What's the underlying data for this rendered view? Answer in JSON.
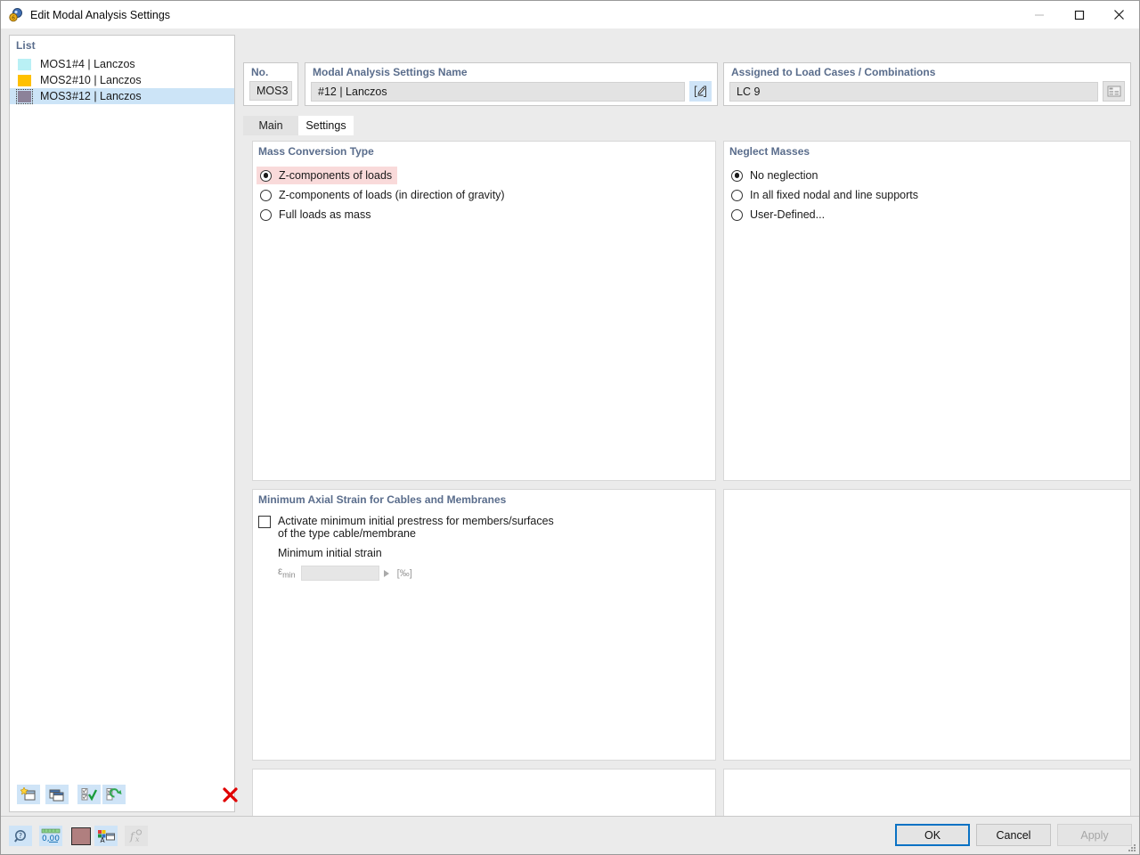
{
  "window": {
    "title": "Edit Modal Analysis Settings",
    "icon": "modal-analysis-icon",
    "controls": {
      "minimize": "minimize-icon",
      "maximize": "maximize-icon",
      "close": "close-icon"
    }
  },
  "list_panel": {
    "header": "List",
    "rows": [
      {
        "no": "MOS1",
        "text": "#4 | Lanczos",
        "color": "#b9f0f5",
        "selected": false
      },
      {
        "no": "MOS2",
        "text": "#10 | Lanczos",
        "color": "#ffc000",
        "selected": false
      },
      {
        "no": "MOS3",
        "text": "#12 | Lanczos",
        "color": "#8c8299",
        "selected": true
      }
    ],
    "toolbar": [
      {
        "name": "new-item-button",
        "icon": "new-window-star-icon"
      },
      {
        "name": "copy-item-button",
        "icon": "copy-windows-icon"
      },
      {
        "name": "select-all-button",
        "icon": "checkbox-check-icon"
      },
      {
        "name": "invert-selection-button",
        "icon": "checkbox-refresh-icon"
      },
      {
        "name": "delete-item-button",
        "icon": "red-x-icon"
      }
    ]
  },
  "no_group": {
    "label": "No.",
    "value": "MOS3"
  },
  "name_group": {
    "label": "Modal Analysis Settings Name",
    "value": "#12 | Lanczos",
    "edit_button_icon": "pencil-edit-icon"
  },
  "assign_group": {
    "label": "Assigned to Load Cases / Combinations",
    "value": "LC 9",
    "select_button_icon": "table-select-icon"
  },
  "tabs": [
    {
      "label": "Main",
      "active": false
    },
    {
      "label": "Settings",
      "active": true
    }
  ],
  "mass_conversion": {
    "title": "Mass Conversion Type",
    "options": [
      {
        "label": "Z-components of loads",
        "selected": true,
        "highlight": true
      },
      {
        "label": "Z-components of loads (in direction of gravity)",
        "selected": false,
        "highlight": false
      },
      {
        "label": "Full loads as mass",
        "selected": false,
        "highlight": false
      }
    ]
  },
  "neglect_masses": {
    "title": "Neglect Masses",
    "options": [
      {
        "label": "No neglection",
        "selected": true
      },
      {
        "label": "In all fixed nodal and line supports",
        "selected": false
      },
      {
        "label": "User-Defined...",
        "selected": false
      }
    ]
  },
  "min_axial_strain": {
    "title": "Minimum Axial Strain for Cables and Membranes",
    "checkbox": {
      "checked": false,
      "line1": "Activate minimum initial prestress for members/surfaces",
      "line2": "of the type cable/membrane"
    },
    "sub_label": "Minimum initial strain",
    "field": {
      "symbol": "ε",
      "subscript": "min",
      "value": "",
      "unit": "[‰]",
      "enabled": false
    }
  },
  "status_icons": [
    {
      "name": "help-search-button",
      "icon": "magnifier-question-icon",
      "enabled": true
    },
    {
      "name": "decimal-places-button",
      "icon": "decimals-000-icon",
      "enabled": true,
      "text": "0,00"
    },
    {
      "name": "color-swatch-button",
      "icon": "color-swatch-icon",
      "enabled": true,
      "color": "#b07f7f"
    },
    {
      "name": "display-props-button",
      "icon": "color-legend-icon",
      "enabled": true
    },
    {
      "name": "formula-button",
      "icon": "formula-fx-icon",
      "enabled": false
    }
  ],
  "dialog_buttons": [
    {
      "label": "OK",
      "state": "default"
    },
    {
      "label": "Cancel",
      "state": "normal"
    },
    {
      "label": "Apply",
      "state": "disabled"
    }
  ],
  "colors": {
    "group_label": "#5a6d8c",
    "selection": "#cce4f7",
    "highlight": "#f9dada",
    "accent": "#0a72c4"
  }
}
